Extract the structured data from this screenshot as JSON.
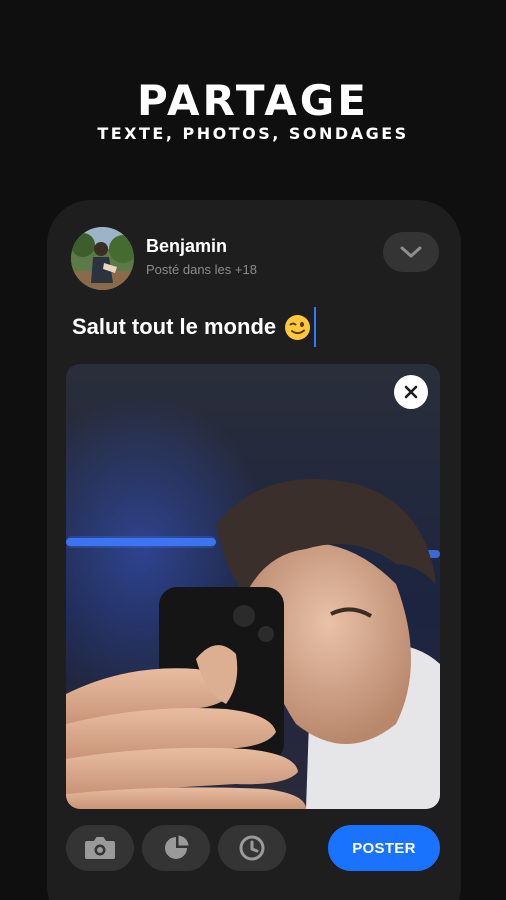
{
  "hero": {
    "title": "PARTAGE",
    "subtitle": "TEXTE, PHOTOS, SONDAGES"
  },
  "post": {
    "author_name": "Benjamin",
    "meta": "Posté dans les +18",
    "text": "Salut tout le monde",
    "emoji_icon": "winking-face",
    "attached_photo": "selfie-photo"
  },
  "toolbar": {
    "tools": [
      {
        "icon": "camera-icon"
      },
      {
        "icon": "pie-chart-icon"
      },
      {
        "icon": "clock-icon"
      }
    ],
    "post_label": "POSTER"
  },
  "colors": {
    "background": "#0f0f0f",
    "card": "#1e1e1e",
    "pill": "#343434",
    "accent": "#1a73ff",
    "caret": "#2f7bff"
  }
}
